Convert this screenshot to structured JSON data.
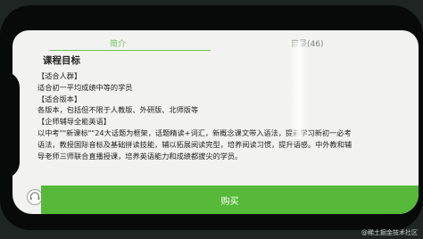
{
  "tabs": [
    {
      "label": "简介",
      "active": true
    },
    {
      "label": "目录(46)",
      "active": false
    }
  ],
  "section_title": "课程目标",
  "lines": [
    "【适合人群】",
    "适合初一平均成绩中等的学员",
    "【适合版本】",
    "各版本，包括但不限于人教版、外研版、北师版等",
    "【企师辅导全能英语】",
    "以中考\"\"新课标\"\"24大话题为框架，话题精读+词汇，新概念课文带入语法，提前学习新初一必考",
    "语法，教授国际音标及基础拼读技能，辅以拓展阅读完型，培养阅读习惯，提升语感。中外教和辅",
    "导老师三师联合直播授课，培养英语能力和成绩都拔尖的学员。"
  ],
  "buy_label": "购买",
  "watermark": "@稀土掘金技术社区",
  "colors": {
    "accent": "#6fc25a",
    "button": "#56b939"
  }
}
